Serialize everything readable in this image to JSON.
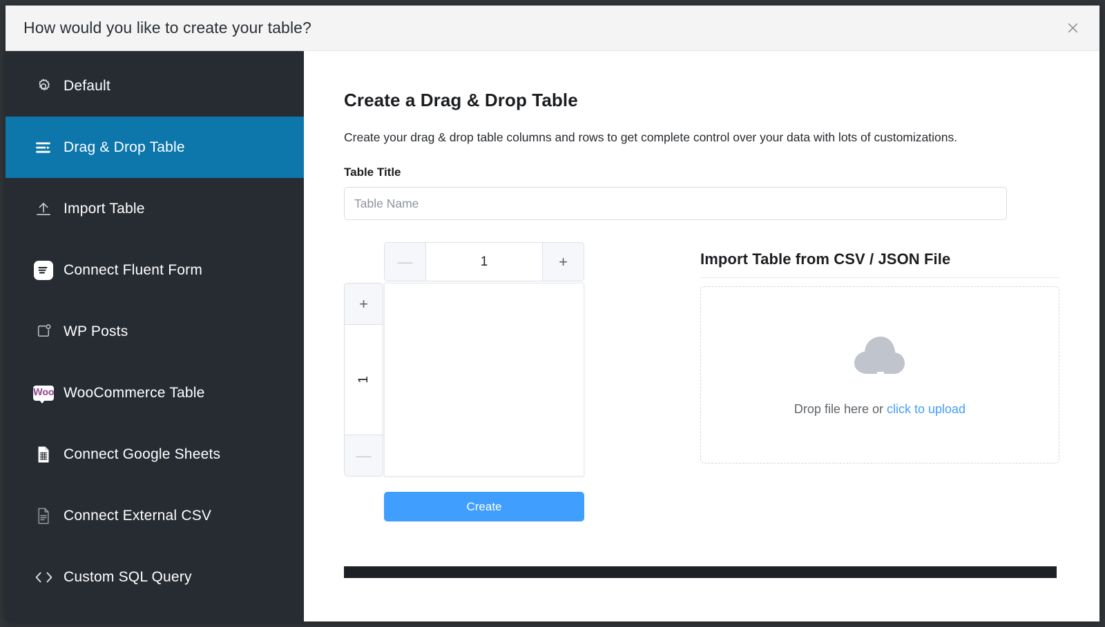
{
  "modal": {
    "title": "How would you like to create your table?",
    "close_icon": "close-icon"
  },
  "sidebar": {
    "items": [
      {
        "label": "Default",
        "icon": "gear-icon",
        "active": false
      },
      {
        "label": "Drag & Drop Table",
        "icon": "drag-drop-list-icon",
        "active": true
      },
      {
        "label": "Import Table",
        "icon": "upload-icon",
        "active": false
      },
      {
        "label": "Connect Fluent Form",
        "icon": "fluent-form-icon",
        "active": false
      },
      {
        "label": "WP Posts",
        "icon": "wp-posts-icon",
        "active": false
      },
      {
        "label": "WooCommerce Table",
        "icon": "woocommerce-icon",
        "active": false
      },
      {
        "label": "Connect Google Sheets",
        "icon": "google-sheets-icon",
        "active": false
      },
      {
        "label": "Connect External CSV",
        "icon": "csv-document-icon",
        "active": false
      },
      {
        "label": "Custom SQL Query",
        "icon": "code-brackets-icon",
        "active": false
      }
    ]
  },
  "main": {
    "heading": "Create a Drag & Drop Table",
    "description": "Create your drag & drop table columns and rows to get complete control over your data with lots of customizations.",
    "table_title_label": "Table Title",
    "table_title_value": "",
    "table_title_placeholder": "Table Name",
    "builder": {
      "columns_decrement": "—",
      "columns_value": "1",
      "columns_increment": "+",
      "rows_increment": "+",
      "rows_value": "1",
      "rows_decrement": "—"
    },
    "create_button": "Create"
  },
  "import": {
    "title": "Import Table from CSV / JSON File",
    "dropzone_icon": "cloud-upload-icon",
    "dropzone_text": "Drop file here or ",
    "dropzone_link": "click to upload"
  },
  "colors": {
    "sidebar_bg": "#272c33",
    "sidebar_active": "#0d76ab",
    "header_bg": "#f4f4f5",
    "accent_blue": "#409eff",
    "page_bg": "#32363a",
    "woo_purple": "#9b5c9b"
  }
}
